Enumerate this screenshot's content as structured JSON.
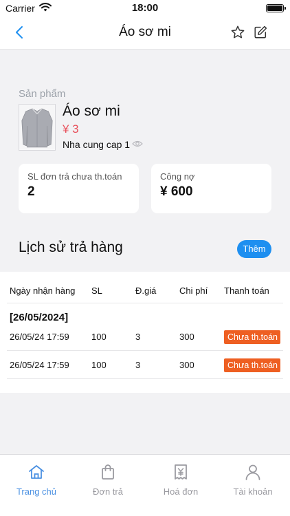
{
  "status_bar": {
    "carrier": "Carrier",
    "time": "18:00"
  },
  "navbar": {
    "title": "Áo sơ mi"
  },
  "product": {
    "section_label": "Sản phẩm",
    "name": "Áo sơ mi",
    "price": "¥ 3",
    "supplier": "Nha cung cap 1"
  },
  "stats": {
    "unpaid_label": "SL đơn trả chưa th.toán",
    "unpaid_value": "2",
    "debt_label": "Công nợ",
    "debt_value": "¥ 600"
  },
  "history": {
    "title": "Lịch sử trả hàng",
    "add_label": "Thêm",
    "columns": [
      "Ngày nhận hàng",
      "SL",
      "Đ.giá",
      "Chi phí",
      "Thanh toán"
    ],
    "group_date": "[26/05/2024]",
    "rows": [
      {
        "date": "26/05/24 17:59",
        "qty": "100",
        "price": "3",
        "cost": "300",
        "payment": "Chưa th.toán"
      },
      {
        "date": "26/05/24 17:59",
        "qty": "100",
        "price": "3",
        "cost": "300",
        "payment": "Chưa th.toán"
      }
    ]
  },
  "tabbar": {
    "items": [
      {
        "label": "Trang chủ",
        "icon": "home-icon",
        "active": true
      },
      {
        "label": "Đơn trả",
        "icon": "bag-icon",
        "active": false
      },
      {
        "label": "Hoá đơn",
        "icon": "invoice-icon",
        "active": false
      },
      {
        "label": "Tài khoản",
        "icon": "person-icon",
        "active": false
      }
    ]
  },
  "colors": {
    "accent": "#1e8ff0",
    "price": "#e8505b",
    "badge": "#ee5f22",
    "active_tab": "#4a90e2"
  }
}
